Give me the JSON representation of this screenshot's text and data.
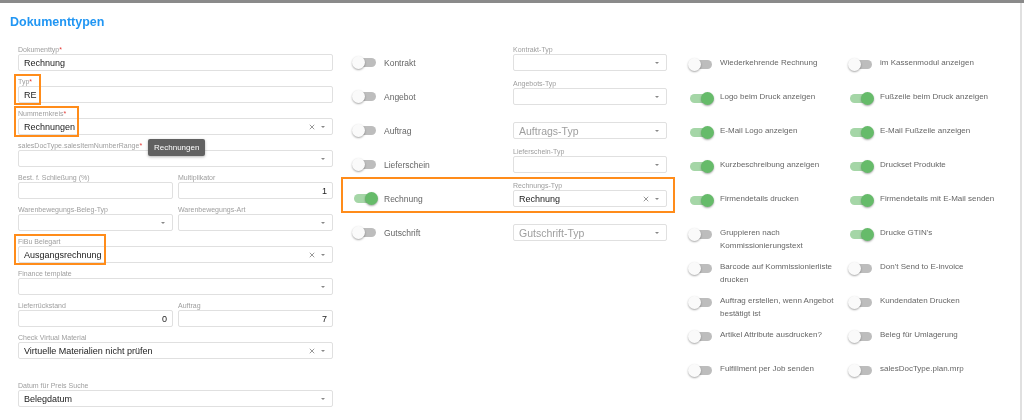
{
  "title": "Dokumenttypen",
  "field_rows": [
    [
      {
        "kind": "text",
        "label": "Dokumenttyp",
        "required_mark": "*",
        "value": "Rechnung"
      }
    ],
    [
      {
        "kind": "text",
        "label": "Typ",
        "required_mark": "*",
        "value": "RE",
        "highlighted": true
      }
    ],
    [
      {
        "kind": "select",
        "label": "Nummernkreis",
        "required_mark": "*",
        "value": "Rechnungen",
        "clearable": true,
        "highlighted": true,
        "tooltip": "Rechnungen"
      }
    ],
    [
      {
        "kind": "select",
        "label": "salesDocType.salesItemNumberRange",
        "required_mark": "*"
      }
    ],
    [
      {
        "kind": "number",
        "label": "Best. f. Schließung (%)"
      },
      {
        "kind": "number",
        "label": "Multiplikator",
        "value": "1"
      }
    ],
    [
      {
        "kind": "select",
        "label": "Warenbewegungs-Beleg-Typ"
      },
      {
        "kind": "select",
        "label": "Warenbewegungs-Art"
      }
    ],
    [
      {
        "kind": "select",
        "label": "FiBu Belegart",
        "value": "Ausgangsrechnung",
        "clearable": true,
        "highlighted": true
      }
    ],
    [
      {
        "kind": "select",
        "label": "Finance template"
      }
    ],
    [
      {
        "kind": "number",
        "label": "Lieferrückstand",
        "value": "0"
      },
      {
        "kind": "number",
        "label": "Auftrag",
        "value": "7"
      }
    ],
    [
      {
        "kind": "select",
        "label": "Check Virtual Material",
        "value": "Virtuelle Materialien nicht prüfen",
        "clearable": true
      }
    ],
    [
      {
        "kind": "select",
        "label": "Datum für Preis Suche",
        "value": "Belegdatum"
      }
    ]
  ],
  "documents": [
    {
      "label": "Kontrakt",
      "on": false,
      "type_label": "Kontrakt-Typ"
    },
    {
      "label": "Angebot",
      "on": false,
      "type_label": "Angebots-Typ"
    },
    {
      "label": "Auftrag",
      "on": false,
      "type_placeholder": "Auftrags-Typ"
    },
    {
      "label": "Lieferschein",
      "on": false,
      "type_label": "Lieferschein-Typ"
    },
    {
      "label": "Rechnung",
      "on": true,
      "type_label": "Rechnungs-Typ",
      "type_value": "Rechnung",
      "clearable": true,
      "highlighted": true
    },
    {
      "label": "Gutschrift",
      "on": false,
      "type_placeholder": "Gutschrift-Typ"
    }
  ],
  "option_rows": [
    [
      {
        "label": "Wiederkehrende Rechnung",
        "on": false
      },
      {
        "label": "im Kassenmodul anzeigen",
        "on": false
      }
    ],
    [
      {
        "label": "Logo beim Druck anzeigen",
        "on": true
      },
      {
        "label": "Fußzeile beim Druck anzeigen",
        "on": true
      }
    ],
    [
      {
        "label": "E-Mail Logo anzeigen",
        "on": true
      },
      {
        "label": "E-Mail Fußzeile anzeigen",
        "on": true
      }
    ],
    [
      {
        "label": "Kurzbeschreibung anzeigen",
        "on": true
      },
      {
        "label": "Druckset Produkte",
        "on": true
      }
    ],
    [
      {
        "label": "Firmendetails drucken",
        "on": true
      },
      {
        "label": "Firmendetails mit E-Mail senden",
        "on": true
      }
    ],
    [
      {
        "label": "Gruppieren nach Kommissionierungstext",
        "on": false
      },
      {
        "label": "Drucke GTIN's",
        "on": true
      }
    ],
    [
      {
        "label": "Barcode auf Kommissionierliste drucken",
        "on": false
      },
      {
        "label": "Don't Send to E-invoice",
        "on": false
      }
    ],
    [
      {
        "label": "Auftrag erstellen, wenn Angebot bestätigt ist",
        "on": false
      },
      {
        "label": "Kundendaten Drucken",
        "on": false
      }
    ],
    [
      {
        "label": "Artikel Attribute ausdrucken?",
        "on": false
      },
      {
        "label": "Beleg für Umlagerung",
        "on": false
      }
    ],
    [
      {
        "label": "Fulfillment per Job senden",
        "on": false
      },
      {
        "label": "salesDocType.plan.mrp",
        "on": false
      }
    ]
  ]
}
